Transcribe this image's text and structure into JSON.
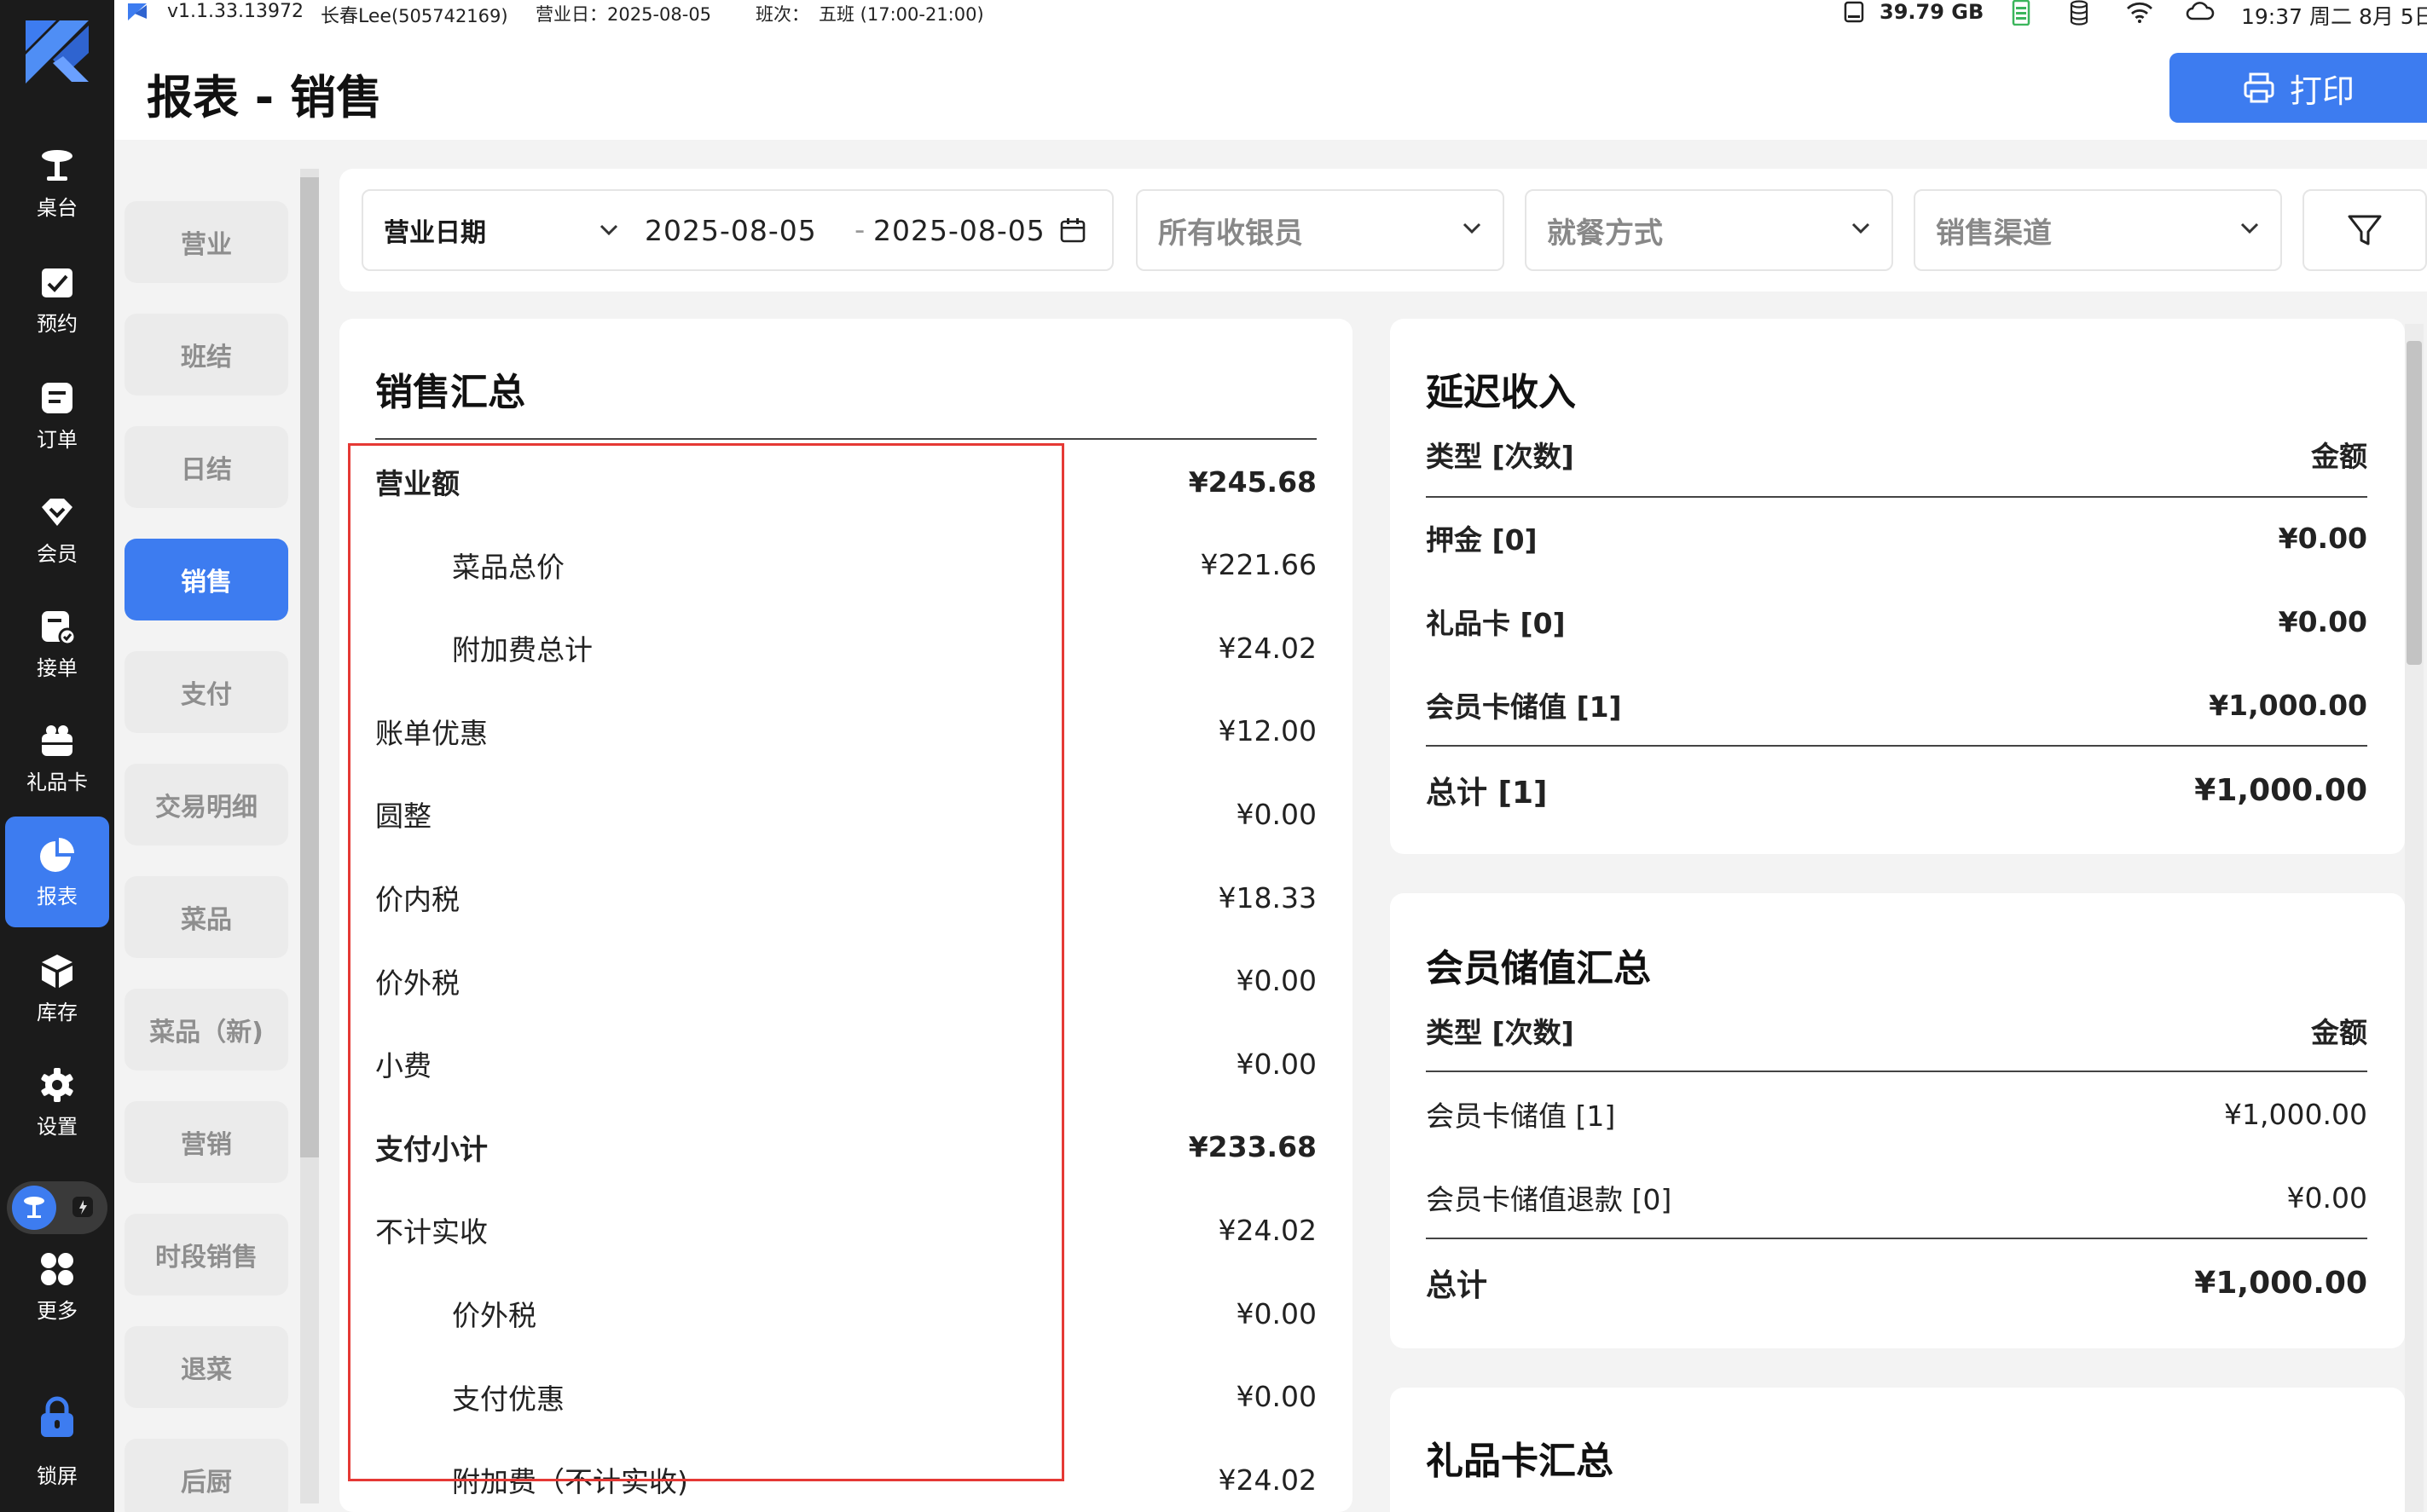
{
  "statusbar": {
    "version": "v1.1.33.13972",
    "user": "长春Lee",
    "user_id": "(505742169)",
    "business_day": "营业日：2025-08-05",
    "shift_label": "班次：",
    "shift_value": "五班 (17:00-21:00)",
    "storage": "39.79 GB",
    "datetime": "19:37 周二 8月 5日"
  },
  "header": {
    "title": "报表 - 销售",
    "print_label": "打印"
  },
  "leftnav": {
    "items": [
      {
        "label": "桌台",
        "icon": "table-icon"
      },
      {
        "label": "预约",
        "icon": "calendar-check-icon"
      },
      {
        "label": "订单",
        "icon": "order-icon"
      },
      {
        "label": "会员",
        "icon": "member-diamond-icon"
      },
      {
        "label": "接单",
        "icon": "accept-order-icon"
      },
      {
        "label": "礼品卡",
        "icon": "gift-card-icon"
      },
      {
        "label": "报表",
        "icon": "pie-chart-icon",
        "active": true
      },
      {
        "label": "库存",
        "icon": "inventory-box-icon"
      },
      {
        "label": "设置",
        "icon": "gear-icon"
      },
      {
        "label": "更多",
        "icon": "more-grid-icon"
      },
      {
        "label": "锁屏",
        "icon": "lock-icon"
      }
    ]
  },
  "subnav": {
    "items": [
      "营业",
      "班结",
      "日结",
      "销售",
      "支付",
      "交易明细",
      "菜品",
      "菜品（新)",
      "营销",
      "时段销售",
      "退菜",
      "后厨"
    ],
    "active_index": 3
  },
  "filters": {
    "date_type": "营业日期",
    "date_from": "2025-08-05",
    "date_sep": "-",
    "date_to": "2025-08-05",
    "cashier": "所有收银员",
    "dining": "就餐方式",
    "channel": "销售渠道"
  },
  "sales_summary": {
    "title": "销售汇总",
    "rows": [
      {
        "label": "营业额",
        "amount": "¥245.68",
        "bold": true,
        "indent": false
      },
      {
        "label": "菜品总价",
        "amount": "¥221.66",
        "bold": false,
        "indent": true
      },
      {
        "label": "附加费总计",
        "amount": "¥24.02",
        "bold": false,
        "indent": true
      },
      {
        "label": "账单优惠",
        "amount": "¥12.00",
        "bold": false,
        "indent": false
      },
      {
        "label": "圆整",
        "amount": "¥0.00",
        "bold": false,
        "indent": false
      },
      {
        "label": "价内税",
        "amount": "¥18.33",
        "bold": false,
        "indent": false
      },
      {
        "label": "价外税",
        "amount": "¥0.00",
        "bold": false,
        "indent": false
      },
      {
        "label": "小费",
        "amount": "¥0.00",
        "bold": false,
        "indent": false
      },
      {
        "label": "支付小计",
        "amount": "¥233.68",
        "bold": true,
        "indent": false
      },
      {
        "label": "不计实收",
        "amount": "¥24.02",
        "bold": false,
        "indent": false
      },
      {
        "label": "价外税",
        "amount": "¥0.00",
        "bold": false,
        "indent": true
      },
      {
        "label": "支付优惠",
        "amount": "¥0.00",
        "bold": false,
        "indent": true
      },
      {
        "label": "附加费（不计实收)",
        "amount": "¥24.02",
        "bold": false,
        "indent": true
      }
    ]
  },
  "deferred_income": {
    "title": "延迟收入",
    "col_type": "类型 [次数]",
    "col_amount": "金额",
    "rows": [
      {
        "label": "押金 [0]",
        "amount": "¥0.00"
      },
      {
        "label": "礼品卡 [0]",
        "amount": "¥0.00"
      },
      {
        "label": "会员卡储值 [1]",
        "amount": "¥1,000.00"
      }
    ],
    "total_label": "总计 [1]",
    "total_amount": "¥1,000.00"
  },
  "member_topup": {
    "title": "会员储值汇总",
    "col_type": "类型 [次数]",
    "col_amount": "金额",
    "rows": [
      {
        "label": "会员卡储值 [1]",
        "amount": "¥1,000.00"
      },
      {
        "label": "会员卡储值退款 [0]",
        "amount": "¥0.00"
      }
    ],
    "total_label": "总计",
    "total_amount": "¥1,000.00"
  },
  "gift_card_summary": {
    "title": "礼品卡汇总"
  },
  "colors": {
    "accent": "#3d7cf0",
    "highlight": "#e53935",
    "nav_bg": "#1b1b1b"
  }
}
